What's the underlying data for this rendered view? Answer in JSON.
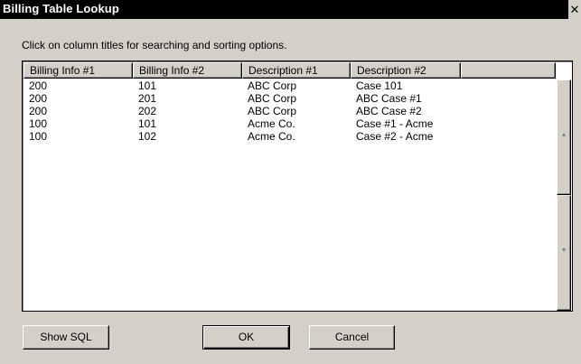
{
  "window": {
    "title": "Billing Table Lookup",
    "close_glyph": "✕",
    "close_icon": "close-icon"
  },
  "instruction": "Click on column titles for searching and sorting options.",
  "table": {
    "columns": [
      "Billing Info #1",
      "Billing Info #2",
      "Description #1",
      "Description #2"
    ],
    "rows": [
      [
        "200",
        "101",
        "ABC Corp",
        "Case 101"
      ],
      [
        "200",
        "201",
        "ABC Corp",
        "ABC Case #1"
      ],
      [
        "200",
        "202",
        "ABC Corp",
        "ABC Case #2"
      ],
      [
        "100",
        "101",
        "Acme Co.",
        "Case #1 - Acme"
      ],
      [
        "100",
        "102",
        "Acme Co.",
        "Case #2 - Acme"
      ]
    ]
  },
  "scrollbar": {
    "up_icon": "scroll-up-arrow-icon",
    "down_icon": "scroll-down-arrow-icon",
    "up_glyph": "▲",
    "down_glyph": "▼"
  },
  "buttons": {
    "show_sql": "Show SQL",
    "ok": "OK",
    "cancel": "Cancel"
  },
  "colors": {
    "titlebar_bg": "#000000",
    "dialog_bg": "#d4d0c8",
    "list_bg": "#ffffff"
  }
}
